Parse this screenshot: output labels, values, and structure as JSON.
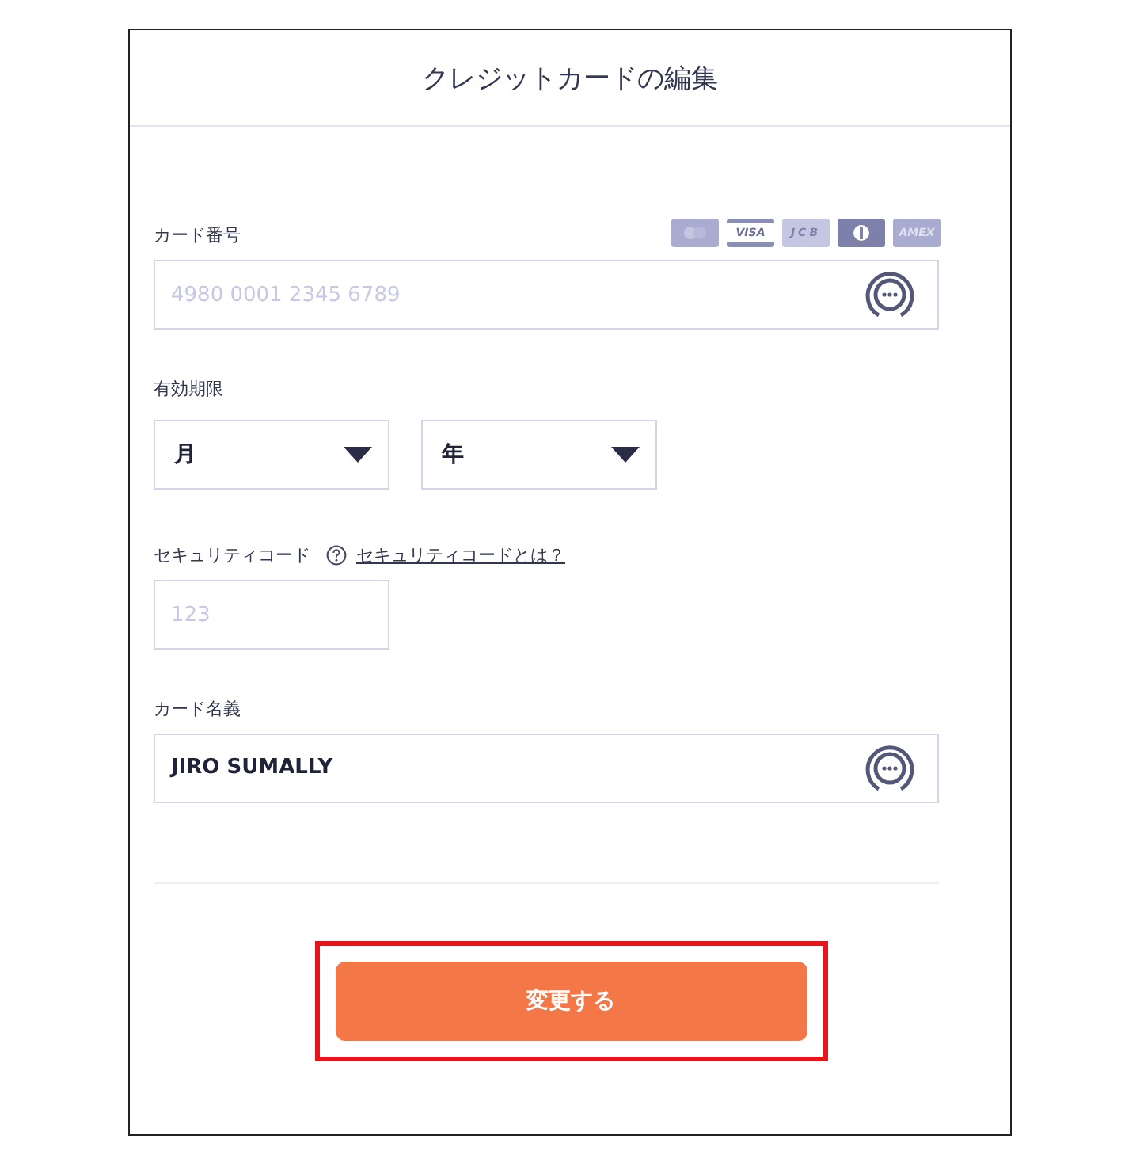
{
  "title": "クレジットカードの編集",
  "card_number": {
    "label": "カード番号",
    "placeholder": "4980 0001 2345 6789",
    "brands": [
      {
        "kind": "mastercard"
      },
      {
        "kind": "visa",
        "label": "VISA"
      },
      {
        "kind": "jcb",
        "label": "JCB"
      },
      {
        "kind": "diners"
      },
      {
        "kind": "amex",
        "label": "AMEX"
      }
    ]
  },
  "expiry": {
    "label": "有効期限",
    "month": "月",
    "year": "年"
  },
  "security_code": {
    "label": "セキュリティコード",
    "help_link": "セキュリティコードとは？",
    "placeholder": "123"
  },
  "card_holder": {
    "label": "カード名義",
    "value": "JIRO SUMALLY"
  },
  "submit": {
    "label": "変更する",
    "highlighted": true
  }
}
